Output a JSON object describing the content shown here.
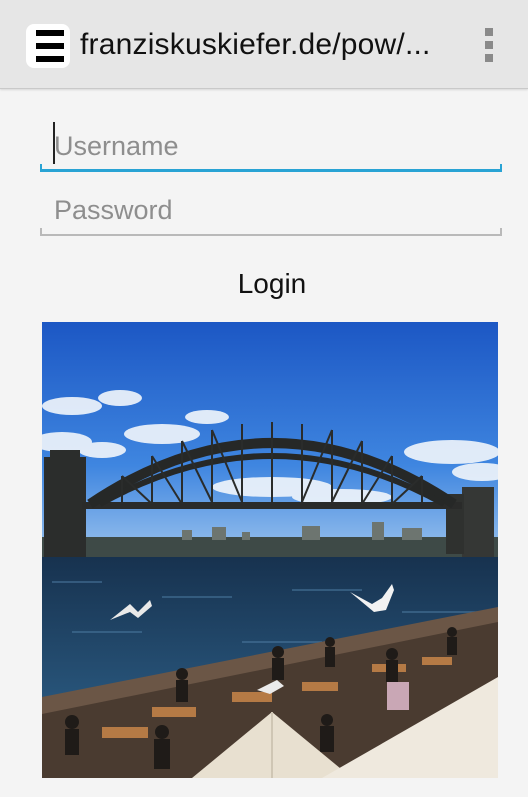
{
  "address_bar": {
    "url": "franziskuskiefer.de/pow/..."
  },
  "icons": {
    "app": "list-icon",
    "menu": "overflow-menu-icon"
  },
  "form": {
    "username": {
      "placeholder": "Username",
      "value": ""
    },
    "password": {
      "placeholder": "Password",
      "value": ""
    },
    "login_label": "Login"
  },
  "colors": {
    "focus_accent": "#29a3d4",
    "topbar": "#e6e6e6",
    "background": "#f4f4f4"
  }
}
